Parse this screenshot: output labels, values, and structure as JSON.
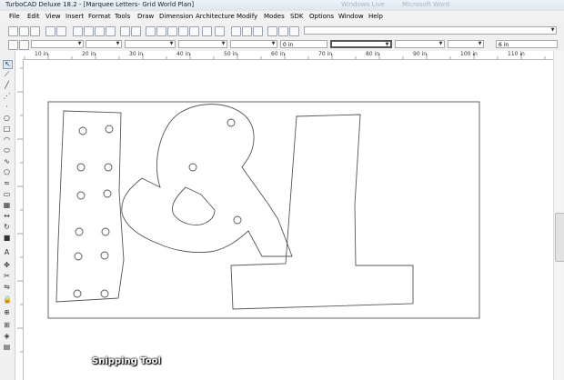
{
  "window": {
    "title": "TurboCAD Deluxe 18.2 - [Marquee Letters- Grid World Plan]",
    "background_ghost": [
      "Windows Live",
      "Microsoft Word"
    ]
  },
  "menu": [
    "File",
    "Edit",
    "View",
    "Insert",
    "Format",
    "Tools",
    "Draw",
    "Dimension",
    "Architecture",
    "Modify",
    "Modes",
    "SDK",
    "Options",
    "Window",
    "Help"
  ],
  "toolbar2": {
    "field_a": "0 in",
    "field_b": "6 in"
  },
  "ruler": {
    "labels": [
      "10 in",
      "20 in",
      "30 in",
      "40 in",
      "50 in",
      "60 in",
      "70 in",
      "80 in",
      "90 in",
      "100 in",
      "110 in"
    ]
  },
  "drawing": {
    "letters": "I&L",
    "stroke_color": "#555555"
  },
  "overlay": {
    "snipping_tool": "Snipping Tool"
  },
  "colors": {
    "toolbar_bg": "#f0f0f0",
    "title_bg": "#dce5ee"
  }
}
